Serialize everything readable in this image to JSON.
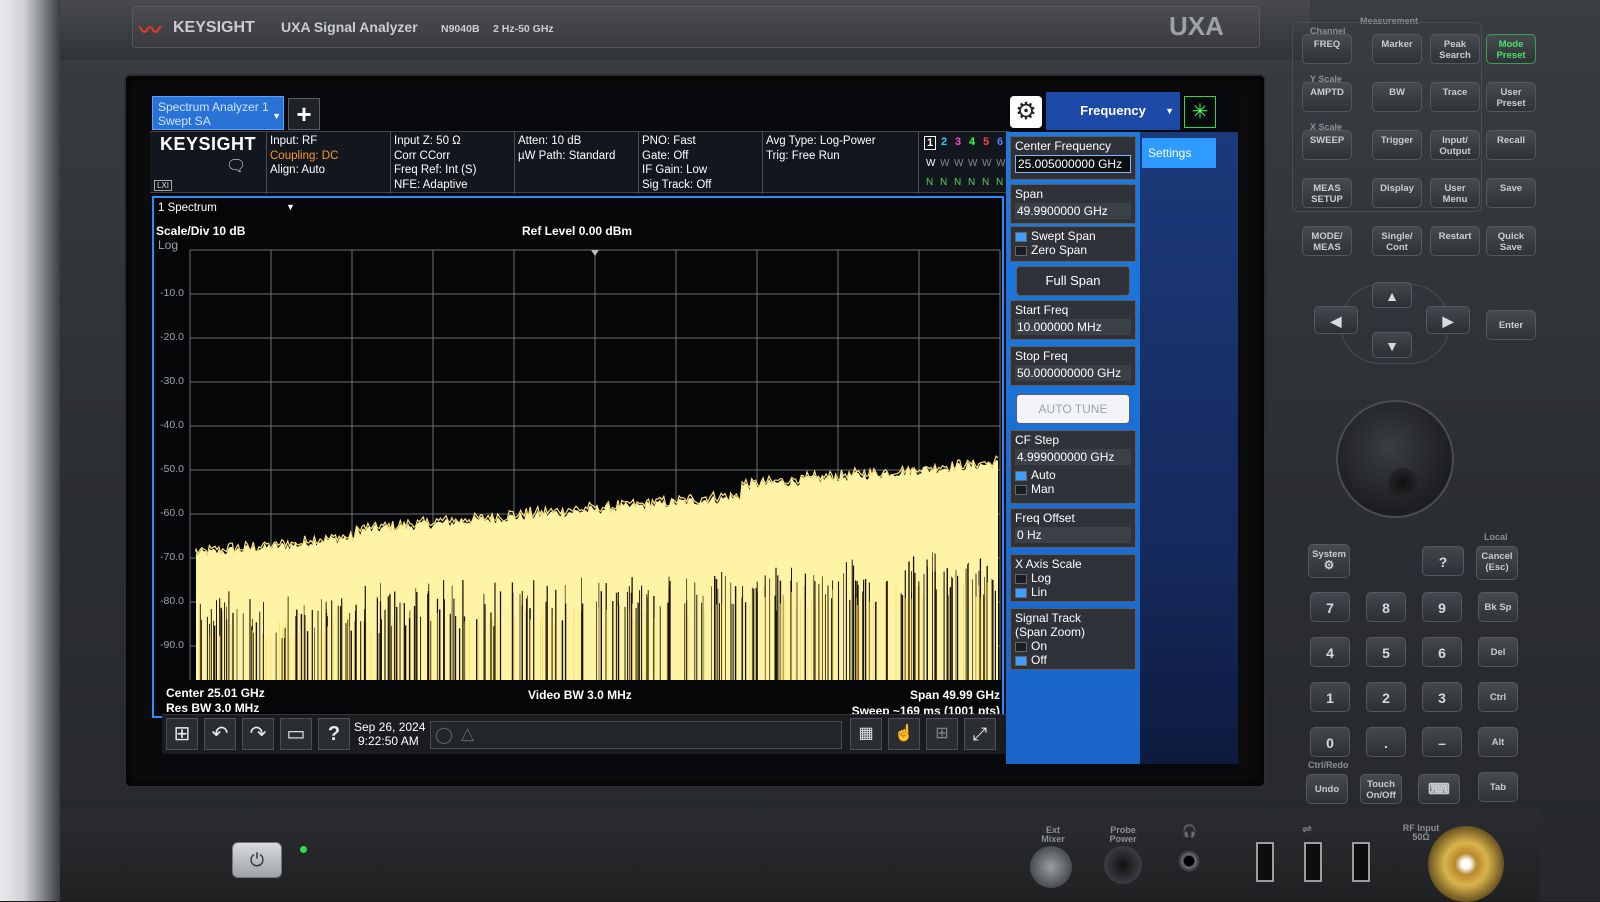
{
  "instrument": {
    "brand": "KEYSIGHT",
    "model_title": "UXA Signal Analyzer",
    "model_number": "N9040B",
    "freq_range": "2 Hz-50 GHz",
    "model_badge": "UXA"
  },
  "screen_tabs": {
    "active_tab_line1": "Spectrum Analyzer 1",
    "active_tab_line2": "Swept SA",
    "add_label": "+"
  },
  "menu_header": {
    "title": "Frequency",
    "settings_label": "Settings"
  },
  "info_bar": {
    "logo": "KEYSIGHT",
    "lxi": "LXI",
    "col1": [
      "Input: RF",
      "Coupling: DC",
      "Align: Auto"
    ],
    "col2": [
      "Input Z: 50 Ω",
      "Corr CCorr",
      "Freq Ref: Int (S)",
      "NFE: Adaptive"
    ],
    "col3": [
      "Atten: 10 dB",
      "µW Path: Standard"
    ],
    "col4": [
      "PNO: Fast",
      "Gate: Off",
      "IF Gain: Low",
      "Sig Track: Off"
    ],
    "col5": [
      "Avg Type: Log-Power",
      "Trig: Free Run"
    ],
    "trace_numbers": [
      "1",
      "2",
      "3",
      "4",
      "5",
      "6"
    ],
    "trace_colors": [
      "#ffffff",
      "#33ccff",
      "#ff44cc",
      "#44ff44",
      "#ff4444",
      "#4488ff"
    ],
    "trace_types": [
      "W",
      "W",
      "W",
      "W",
      "W",
      "W"
    ],
    "trace_detectors": [
      "N",
      "N",
      "N",
      "N",
      "N",
      "N"
    ]
  },
  "graph": {
    "window_title": "1 Spectrum",
    "scale_div": "Scale/Div 10 dB",
    "scale_type": "Log",
    "ref_level": "Ref Level 0.00 dBm",
    "y_labels": [
      "-10.0",
      "-20.0",
      "-30.0",
      "-40.0",
      "-50.0",
      "-60.0",
      "-70.0",
      "-80.0",
      "-90.0"
    ],
    "center": "Center 25.01 GHz",
    "res_bw": "Res BW 3.0 MHz",
    "video_bw": "Video BW 3.0 MHz",
    "span": "Span 49.99 GHz",
    "sweep": "Sweep ~169 ms (1001 pts)",
    "trace_color": "#fff3a6"
  },
  "taskbar": {
    "date": "Sep 26, 2024",
    "time": "9:22:50 AM"
  },
  "softkeys": {
    "center_freq_label": "Center Frequency",
    "center_freq_value": "25.005000000 GHz",
    "span_label": "Span",
    "span_value": "49.9900000 GHz",
    "swept_span": "Swept Span",
    "zero_span": "Zero Span",
    "full_span": "Full Span",
    "start_freq_label": "Start Freq",
    "start_freq_value": "10.000000 MHz",
    "stop_freq_label": "Stop Freq",
    "stop_freq_value": "50.000000000 GHz",
    "auto_tune": "AUTO TUNE",
    "cf_step_label": "CF Step",
    "cf_step_value": "4.999000000 GHz",
    "auto": "Auto",
    "man": "Man",
    "freq_offset_label": "Freq Offset",
    "freq_offset_value": "0 Hz",
    "x_axis_label": "X Axis Scale",
    "log": "Log",
    "lin": "Lin",
    "signal_track_label_1": "Signal Track",
    "signal_track_label_2": "(Span Zoom)",
    "on": "On",
    "off": "Off"
  },
  "front_panel": {
    "measurement": "Measurement",
    "channel": "Channel",
    "y_scale": "Y Scale",
    "x_scale": "X Scale",
    "local": "Local",
    "ctrl_redo": "Ctrl/Redo",
    "keys_row1": [
      "FREQ",
      "Marker",
      "Peak Search",
      "Mode Preset"
    ],
    "keys_row2": [
      "AMPTD",
      "BW",
      "Trace",
      "User Preset"
    ],
    "keys_row3": [
      "SWEEP",
      "Trigger",
      "Input/ Output",
      "Recall"
    ],
    "keys_row4": [
      "MEAS SETUP",
      "Display",
      "User Menu",
      "Save"
    ],
    "keys_row5": [
      "MODE/ MEAS",
      "Single/ Cont",
      "Restart",
      "Quick Save"
    ],
    "enter": "Enter",
    "system": "System",
    "help": "?",
    "cancel": "Cancel (Esc)",
    "numpad": [
      "7",
      "8",
      "9",
      "4",
      "5",
      "6",
      "1",
      "2",
      "3",
      "0",
      ".",
      "–"
    ],
    "side_keys": [
      "Bk Sp",
      "Del",
      "Ctrl",
      "Alt",
      "Tab"
    ],
    "undo": "Undo",
    "touch": "Touch On/Off",
    "ext_mixer": "Ext Mixer",
    "probe_power": "Probe Power",
    "rf_input": "RF Input 50Ω"
  }
}
